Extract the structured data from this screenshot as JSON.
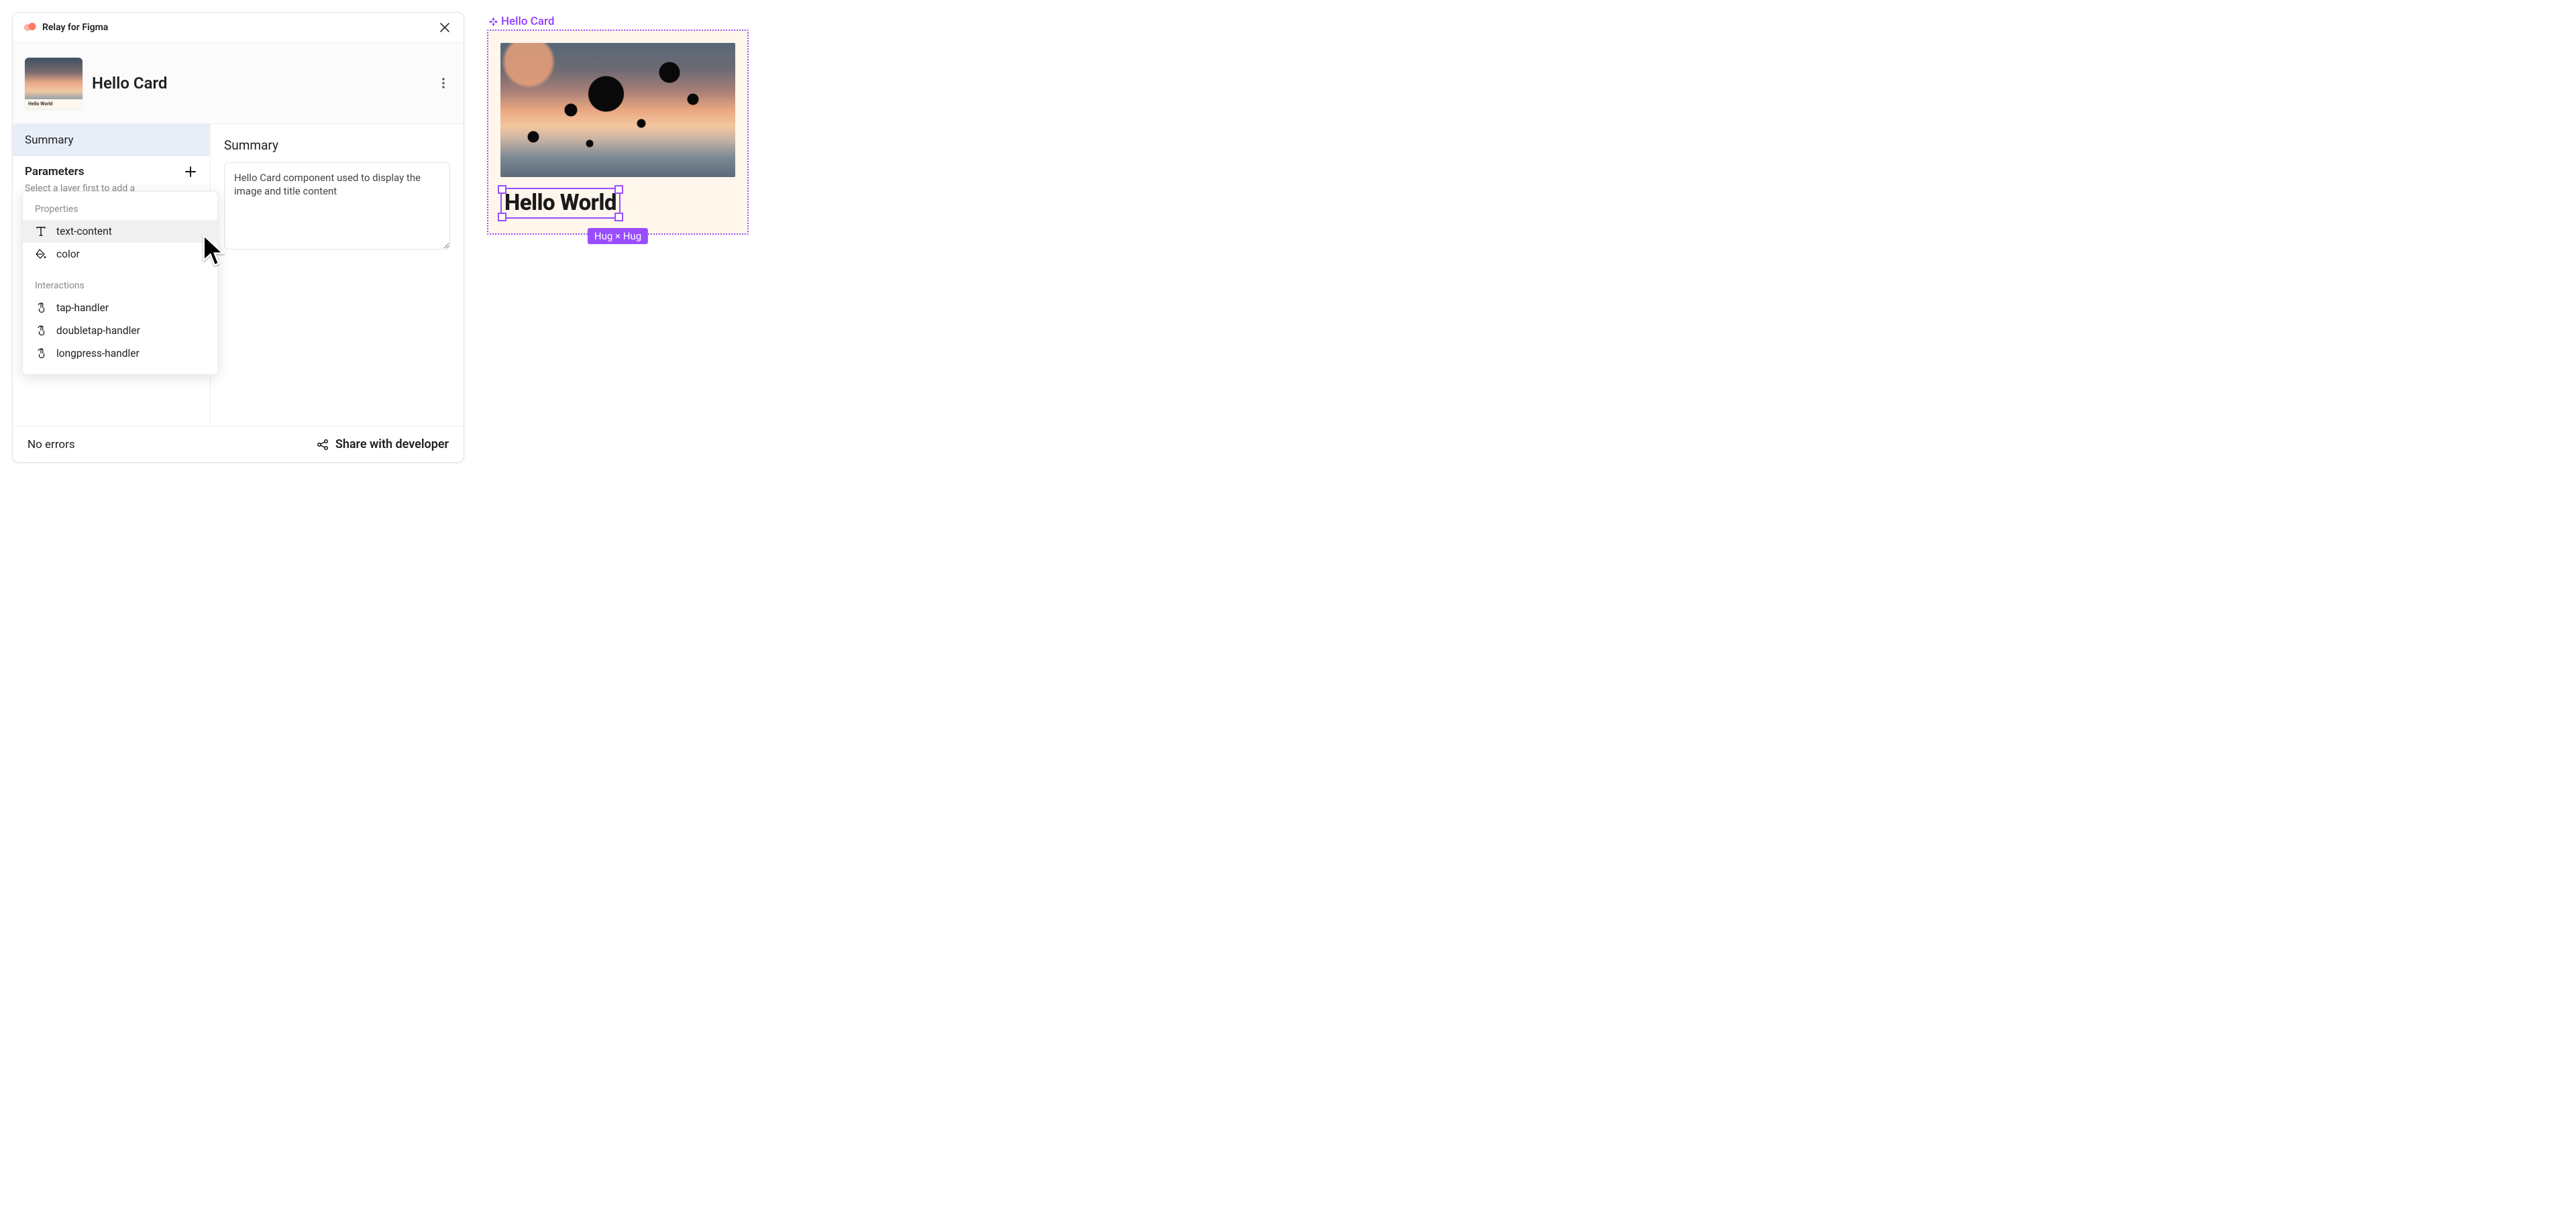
{
  "panel": {
    "plugin_name": "Relay for Figma",
    "component_title": "Hello Card",
    "thumb_caption": "Hello World",
    "sidebar": {
      "tab_summary": "Summary",
      "parameters_label": "Parameters",
      "hint_truncated": "Select a layer first to add a"
    },
    "content": {
      "heading": "Summary",
      "summary_text": "Hello Card component used to display the image and title content"
    },
    "footer": {
      "status": "No errors",
      "share_label": "Share with developer"
    }
  },
  "popover": {
    "section_properties": "Properties",
    "section_interactions": "Interactions",
    "properties": [
      {
        "id": "text-content",
        "label": "text-content",
        "icon": "type"
      },
      {
        "id": "color",
        "label": "color",
        "icon": "paint"
      }
    ],
    "interactions": [
      {
        "id": "tap",
        "label": "tap-handler"
      },
      {
        "id": "doubletap",
        "label": "doubletap-handler"
      },
      {
        "id": "longpress",
        "label": "longpress-handler"
      }
    ]
  },
  "canvas": {
    "component_label": "Hello Card",
    "selected_text": "Hello World",
    "constraint_badge": "Hug × Hug"
  },
  "colors": {
    "accent_purple": "#9a4dff",
    "logo_coral": "#ff7a66"
  }
}
